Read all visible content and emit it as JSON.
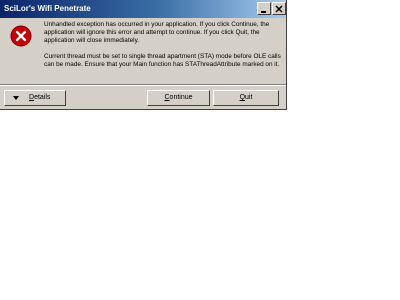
{
  "window": {
    "title": "SciLor's Wifi Penetrate"
  },
  "icons": {
    "minimize": "minimize-icon",
    "close": "close-icon",
    "error": "error-icon",
    "details_arrow": "chevron-down-icon"
  },
  "colors": {
    "titlebar_start": "#0a246a",
    "titlebar_end": "#a6caf0",
    "error_red": "#cc0000",
    "dialog_bg": "#d4d0c8"
  },
  "message": {
    "paragraph1": "Unhandled exception has occurred in your application. If you click Continue, the application will ignore this error and attempt to continue. If you click Quit, the application will close immediately.",
    "paragraph2": "Current thread must be set to single thread apartment (STA) mode before OLE calls can be made. Ensure that your Main function has STAThreadAttribute marked on it."
  },
  "buttons": {
    "details": {
      "mnemonic": "D",
      "rest": "etails"
    },
    "continue": {
      "mnemonic": "C",
      "rest": "ontinue"
    },
    "quit": {
      "mnemonic": "Q",
      "rest": "uit"
    }
  }
}
